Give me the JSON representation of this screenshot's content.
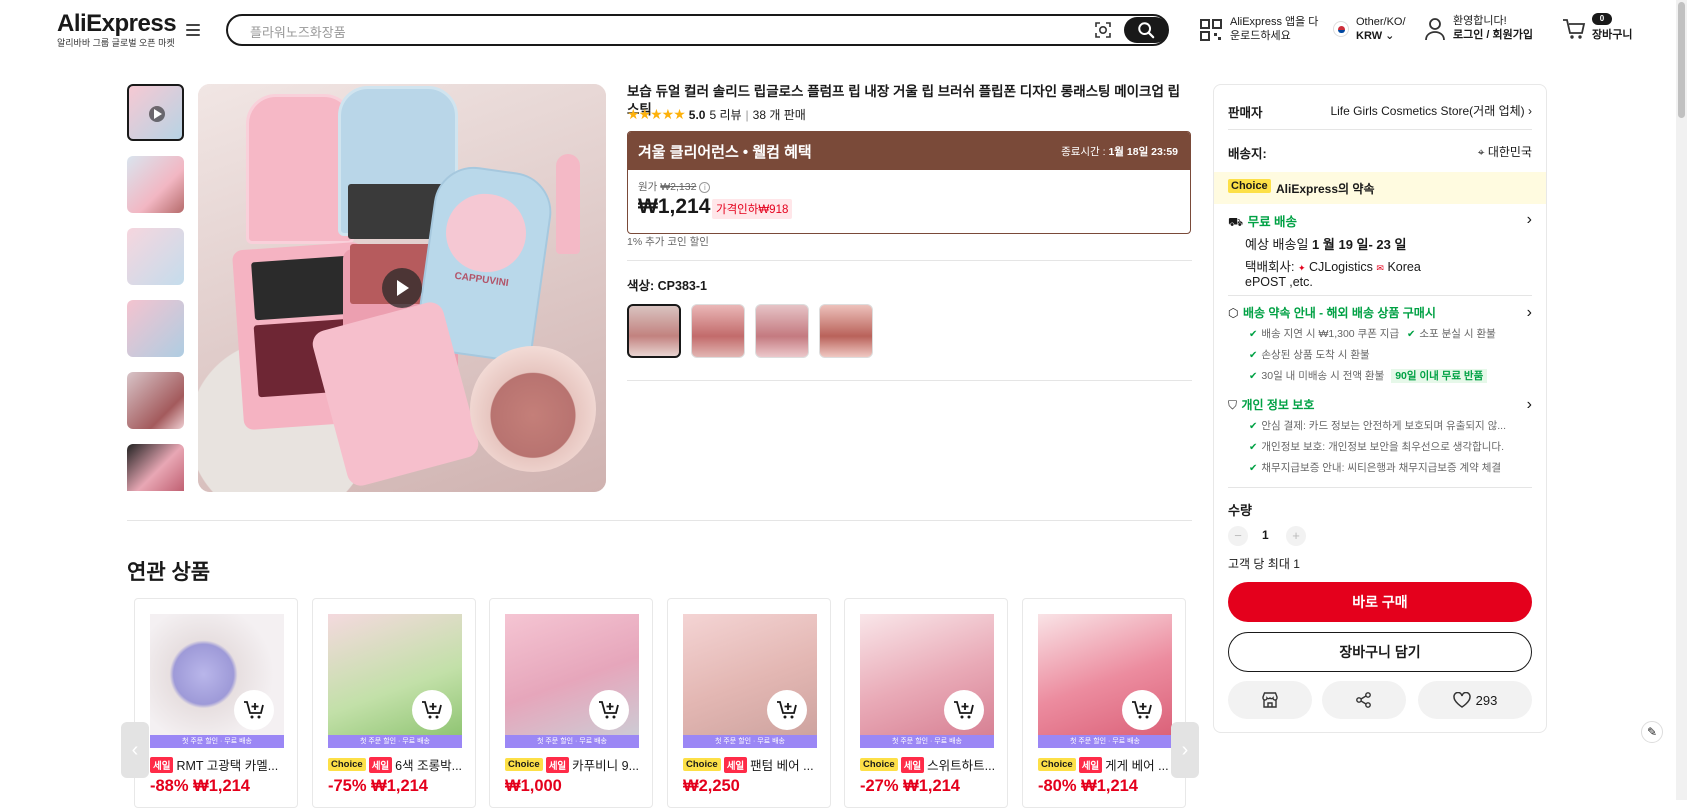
{
  "header": {
    "logo": "AliExpress",
    "logo_sub": "알리바바 그룹 글로벌 오픈 마켓",
    "search_placeholder": "플라워노즈화장품",
    "app_line1": "AliExpress 앱을 다",
    "app_line2": "운로드하세요",
    "region_line1": "Other/KO/",
    "region_line2": "KRW",
    "account_line1": "환영합니다!",
    "account_line2": "로그인 / 회원가입",
    "cart_count": "0",
    "cart_label": "장바구니"
  },
  "product": {
    "title": "보습 듀얼 컬러 솔리드 립글로스 플럼프 립 내장 거울 립 브러쉬 플립폰 디자인 롱래스팅 메이크업 립스틱",
    "rating": "5.0",
    "reviews": "5 리뷰",
    "sold": "38 개 판매",
    "promo_title": "겨울 클리어런스 • 웰컴 혜택",
    "promo_end_label": "종료시간 :",
    "promo_end_value": "1월 18일 23:59",
    "orig_label": "원가",
    "orig_price": "₩2,132",
    "price": "₩1,214",
    "discount_tag": "가격인하₩918",
    "coin_note": "1% 추가 코인 할인",
    "color_label": "색상: CP383-1",
    "image_brand": "CAPPUVINI"
  },
  "panel": {
    "seller_label": "판매자",
    "seller_name": "Life Girls Cosmetics Store(거래 업체)",
    "ship_to_label": "배송지:",
    "ship_to_value": "대한민국",
    "choice_badge": "Choice",
    "choice_text": "AliExpress의 약속",
    "free_ship": "무료 배송",
    "eta_prefix": "예상 배송일",
    "eta_value": "1 월 19 일- 23 일",
    "courier_label": "택배회사:",
    "courier1": "CJLogistics",
    "courier2": "Korea",
    "courier3": "ePOST ,etc.",
    "promise_title": "배송 약속 안내 - 해외 배송 상품 구매시",
    "promise1": "배송 지연 시 ₩1,300 쿠폰 지급",
    "promise2": "소포 분실 시 환불",
    "promise3": "손상된 상품 도착 시 환불",
    "promise4": "30일 내 미배송 시 전액 환불",
    "promise4_tag": "90일 이내 무료 반품",
    "privacy_title": "개인 정보 보호",
    "privacy1": "안심 결제: 카드 정보는 안전하게 보호되며 유출되지 않...",
    "privacy2": "개인정보 보호: 개인정보 보안을 최우선으로 생각합니다.",
    "privacy3": "채무지급보증 안내: 씨티은행과 채무지급보증 계약 체결",
    "qty_label": "수량",
    "qty_minus": "−",
    "qty_value": "1",
    "qty_plus": "+",
    "max_note": "고객 당 최대 1",
    "buy_now": "바로 구매",
    "add_cart": "장바구니 담기",
    "wish_count": "293"
  },
  "related": {
    "title": "연관 상품",
    "strip": "첫 주문 할인 · 무료 배송",
    "items": [
      {
        "name": "RMT 고광택 카멜...",
        "choice": "",
        "sale": "세일",
        "discount": "-88%",
        "price": "₩1,214"
      },
      {
        "name": "6색 조롱박...",
        "choice": "Choice",
        "sale": "세일",
        "discount": "-75%",
        "price": "₩1,214"
      },
      {
        "name": "카푸비니 9...",
        "choice": "Choice",
        "sale": "세일",
        "discount": "",
        "price": "₩1,000"
      },
      {
        "name": "팬텀 베어 ...",
        "choice": "Choice",
        "sale": "세일",
        "discount": "",
        "price": "₩2,250"
      },
      {
        "name": "스위트하트...",
        "choice": "Choice",
        "sale": "세일",
        "discount": "-27%",
        "price": "₩1,214"
      },
      {
        "name": "게게 베어 ...",
        "choice": "Choice",
        "sale": "세일",
        "discount": "-80%",
        "price": "₩1,214"
      }
    ]
  },
  "colors": {
    "accent_red": "#e4001c",
    "promo_brown": "#7a4a39",
    "green": "#00a144",
    "strip_purple": "#9b87f5"
  }
}
